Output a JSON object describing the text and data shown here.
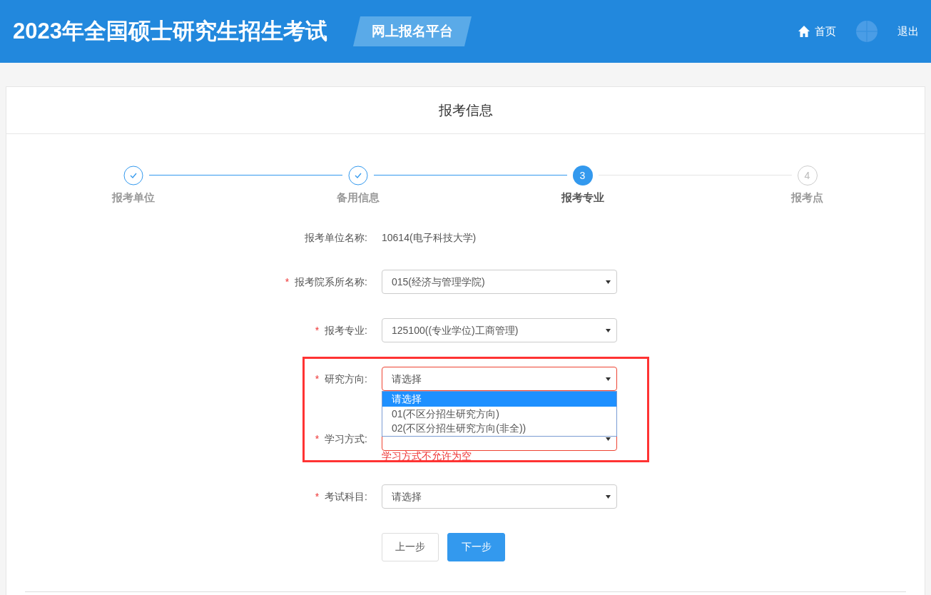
{
  "header": {
    "title": "2023年全国硕士研究生招生考试",
    "platform_tag": "网上报名平台",
    "nav": [
      {
        "kind": "home",
        "label": "首页"
      },
      {
        "kind": "avatar"
      },
      {
        "kind": "logout",
        "label": "退出"
      }
    ]
  },
  "card": {
    "title": "报考信息",
    "steps": [
      {
        "label": "报考单位",
        "completed": true,
        "selected": false
      },
      {
        "label": "备用信息",
        "completed": true,
        "selected": false
      },
      {
        "label": "报考专业",
        "completed": false,
        "selected": true,
        "number": "3"
      },
      {
        "label": "报考点",
        "completed": false,
        "selected": false,
        "number": "4"
      }
    ],
    "form": [
      {
        "kind": "text",
        "label": "报考单位名称:",
        "value": "10614(电子科技大学)",
        "highlighted": false
      },
      {
        "kind": "select",
        "label": "报考院系所名称:",
        "required_mark": "*",
        "value": "015(经济与管理学院)",
        "invalid": false,
        "highlighted": false
      },
      {
        "kind": "select",
        "label": "报考专业:",
        "required_mark": "*",
        "value": "125100((专业学位)工商管理)",
        "invalid": false,
        "highlighted": false
      },
      {
        "kind": "select",
        "label": "研究方向:",
        "required_mark": "*",
        "value": "请选择",
        "invalid": true,
        "highlighted": true,
        "open": true,
        "options": [
          {
            "label": "请选择",
            "selected": true
          },
          {
            "label": "01(不区分招生研究方向)",
            "selected": false
          },
          {
            "label": "02(不区分招生研究方向(非全))",
            "selected": false
          }
        ]
      },
      {
        "kind": "select",
        "label": "学习方式:",
        "required_mark": "*",
        "invalid": true,
        "highlighted": true,
        "error": "学习方式不允许为空"
      },
      {
        "kind": "select",
        "label": "考试科目:",
        "required_mark": "*",
        "value": "请选择",
        "invalid": false,
        "highlighted": false
      }
    ],
    "buttons": [
      {
        "label": "上一步",
        "primary": false
      },
      {
        "label": "下一步",
        "primary": true
      }
    ]
  }
}
